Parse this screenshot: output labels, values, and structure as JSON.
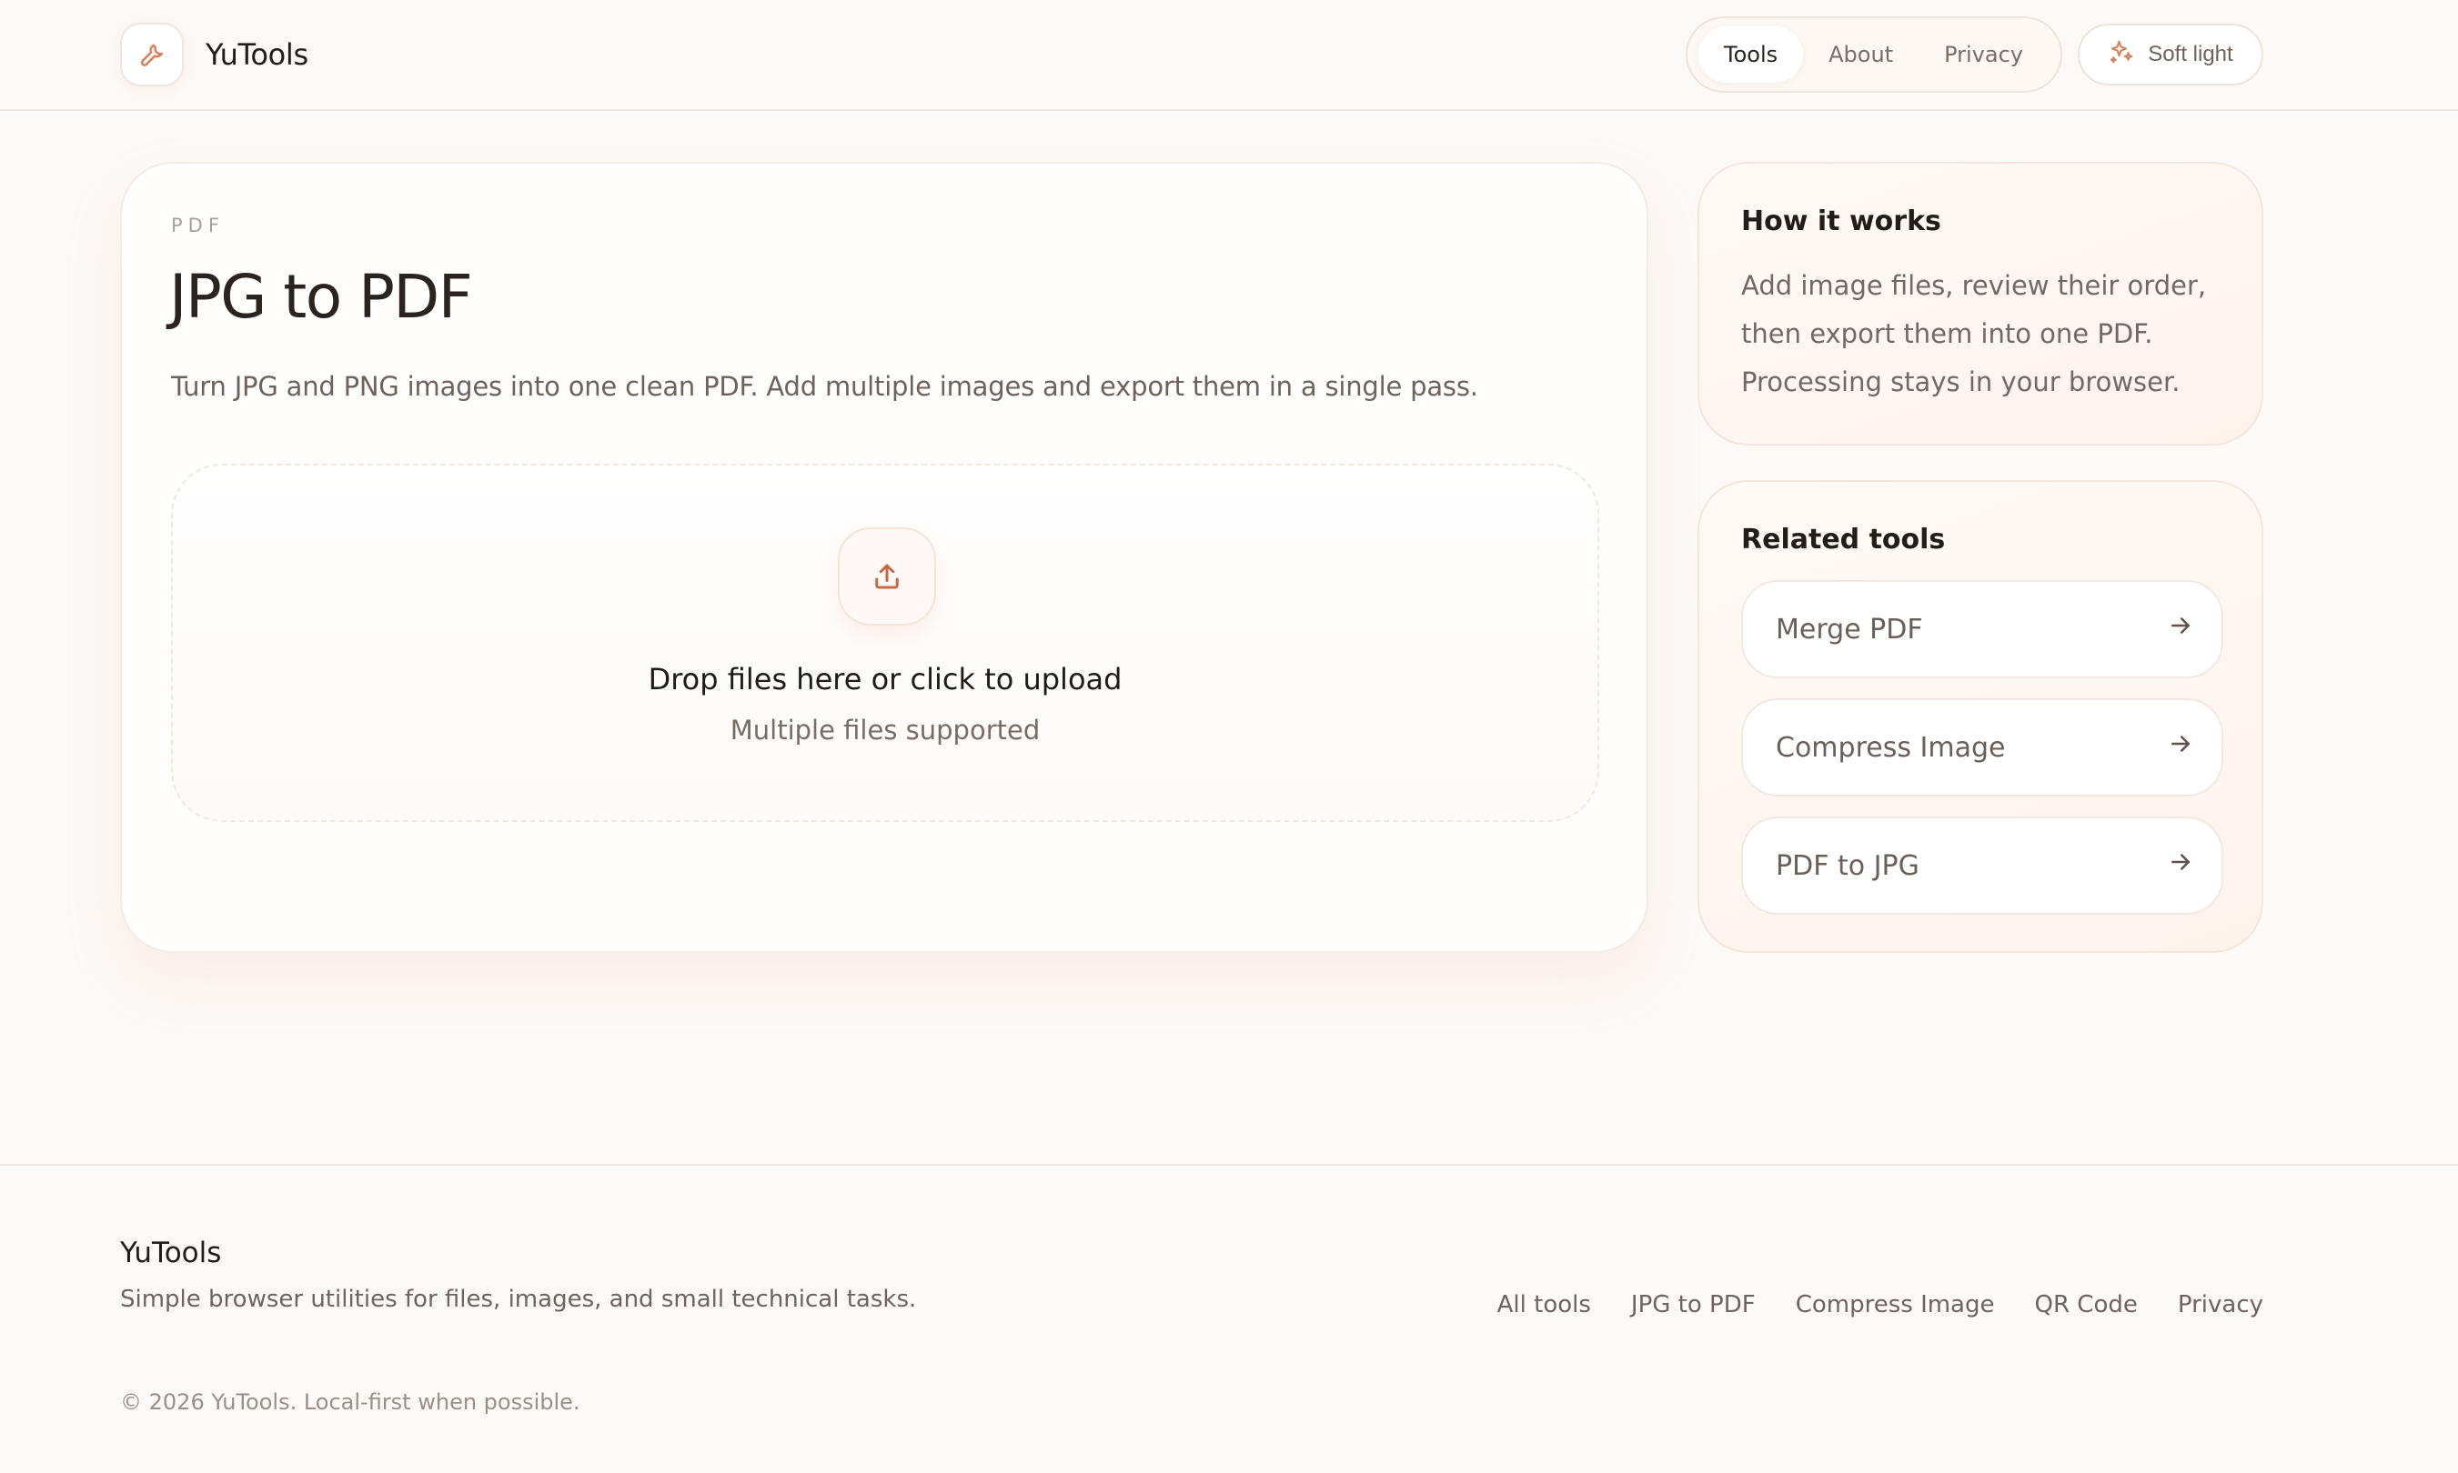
{
  "brand": {
    "name": "YuTools",
    "icon": "wrench-icon"
  },
  "nav": {
    "items": [
      {
        "label": "Tools",
        "active": true
      },
      {
        "label": "About",
        "active": false
      },
      {
        "label": "Privacy",
        "active": false
      }
    ]
  },
  "theme_toggle": {
    "label": "Soft light",
    "icon": "sparkle-icon"
  },
  "main": {
    "eyebrow": "PDF",
    "title": "JPG to PDF",
    "description": "Turn JPG and PNG images into one clean PDF. Add multiple images and export them in a single pass.",
    "dropzone": {
      "icon": "upload-icon",
      "title": "Drop files here or click to upload",
      "subtitle": "Multiple files supported"
    }
  },
  "how_it_works": {
    "title": "How it works",
    "text": "Add image files, review their order, then export them into one PDF. Processing stays in your browser."
  },
  "related_tools": {
    "title": "Related tools",
    "items": [
      {
        "label": "Merge PDF",
        "icon": "arrow-right-icon"
      },
      {
        "label": "Compress Image",
        "icon": "arrow-right-icon"
      },
      {
        "label": "PDF to JPG",
        "icon": "arrow-right-icon"
      }
    ]
  },
  "footer": {
    "brand": "YuTools",
    "tagline": "Simple browser utilities for files, images, and small technical tasks.",
    "links": [
      "All tools",
      "JPG to PDF",
      "Compress Image",
      "QR Code",
      "Privacy"
    ],
    "copyright": "© 2026 YuTools. Local-first when possible."
  },
  "colors": {
    "accent": "#d9835e",
    "background": "#fdf9f6",
    "text": "#2b2522",
    "muted": "#746862"
  }
}
